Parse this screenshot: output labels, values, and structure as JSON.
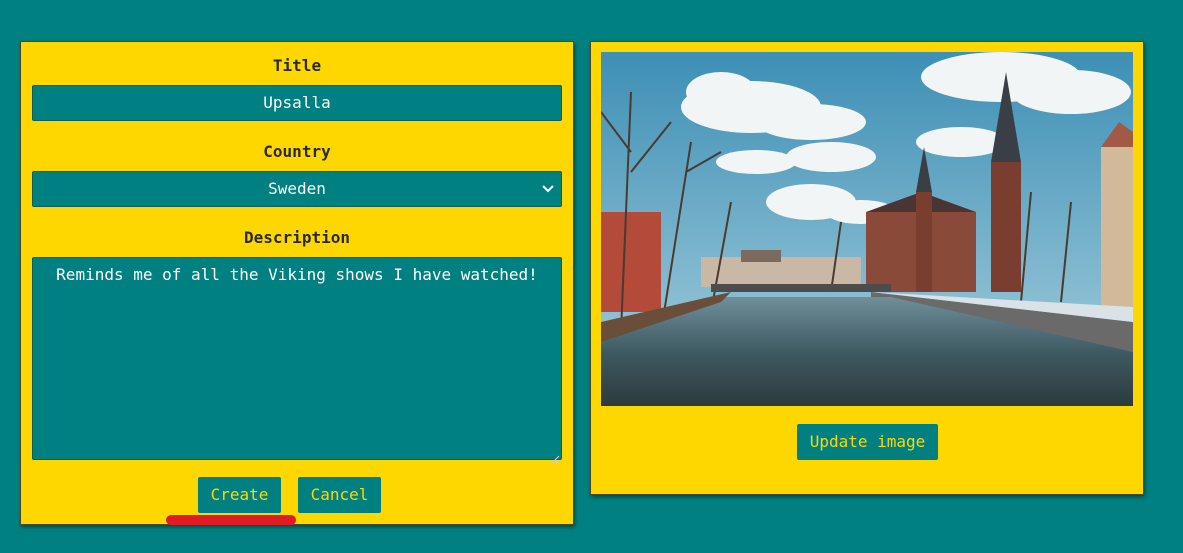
{
  "form": {
    "title_label": "Title",
    "title_value": "Upsalla",
    "country_label": "Country",
    "country_value": "Sweden",
    "description_label": "Description",
    "description_value": "Reminds me of all the Viking shows I have watched!",
    "create_label": "Create",
    "cancel_label": "Cancel"
  },
  "image_panel": {
    "update_label": "Update image"
  },
  "colors": {
    "background": "#008080",
    "card": "#FFD700",
    "annotation": "#e01b24"
  },
  "icons": {
    "select_arrow": "chevron-down-icon",
    "resize": "resize-handle-icon"
  }
}
